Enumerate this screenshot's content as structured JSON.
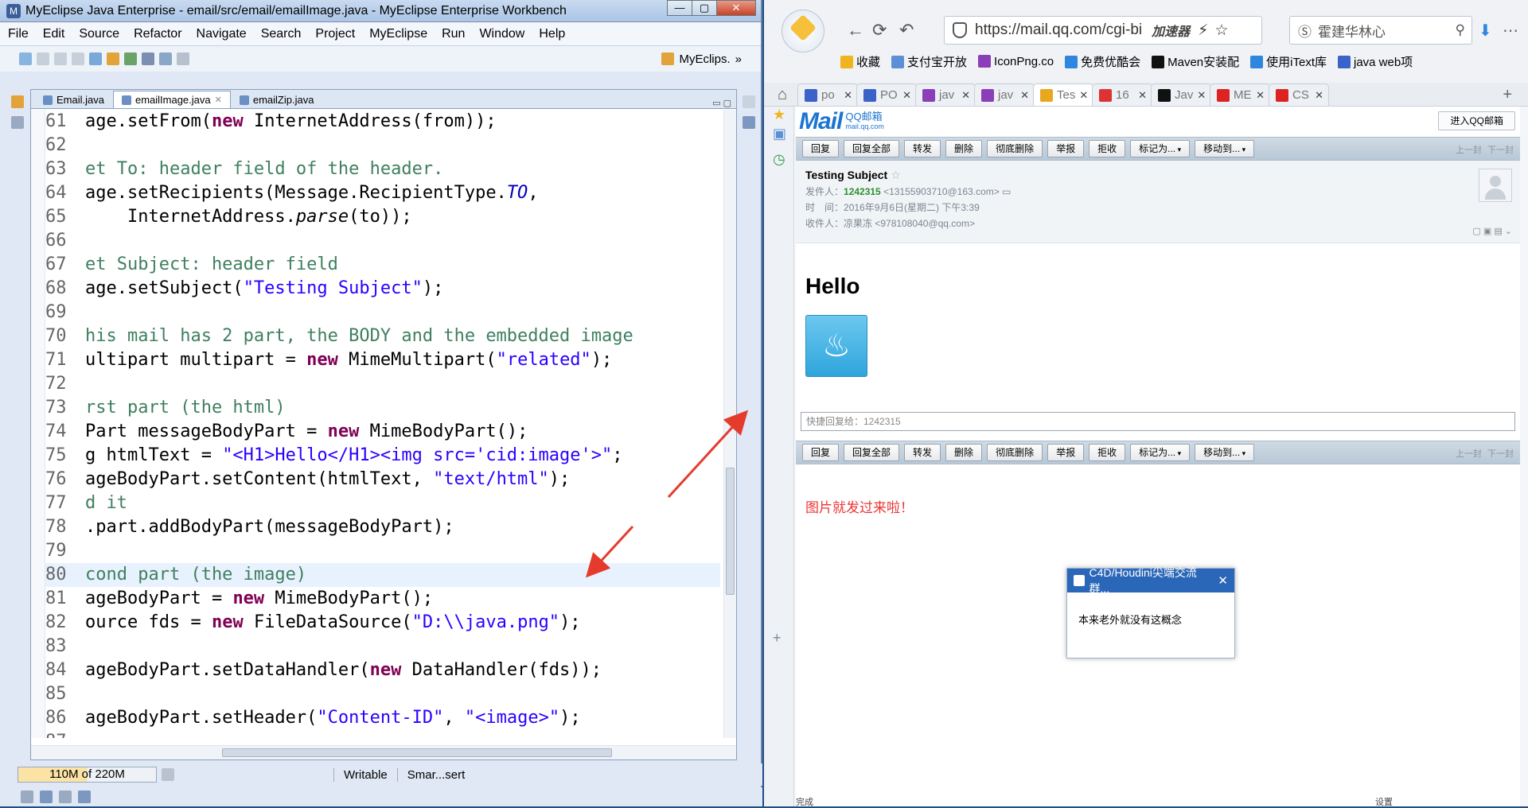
{
  "eclipse": {
    "title": "MyEclipse Java Enterprise - email/src/email/emailImage.java - MyEclipse Enterprise Workbench",
    "menu": [
      "File",
      "Edit",
      "Source",
      "Refactor",
      "Navigate",
      "Search",
      "Project",
      "MyEclipse",
      "Run",
      "Window",
      "Help"
    ],
    "perspective": "MyEclips.",
    "tabs": [
      {
        "label": "Email.java",
        "active": false
      },
      {
        "label": "emailImage.java",
        "active": true
      },
      {
        "label": "emailZip.java",
        "active": false
      }
    ],
    "code_lines": [
      {
        "n": "61",
        "html": "age.setFrom(<span class=\"kw\">new</span> InternetAddress(from));"
      },
      {
        "n": "62",
        "html": ""
      },
      {
        "n": "63",
        "html": "<span class=\"cm\">et To: header field of the header.</span>"
      },
      {
        "n": "64",
        "html": "age.setRecipients(Message.RecipientType.<span class=\"stat\">TO</span>,"
      },
      {
        "n": "65",
        "html": "    InternetAddress.<span class=\"it\">parse</span>(to));"
      },
      {
        "n": "66",
        "html": ""
      },
      {
        "n": "67",
        "html": "<span class=\"cm\">et Subject: header field</span>"
      },
      {
        "n": "68",
        "html": "age.setSubject(<span class=\"str\">\"Testing Subject\"</span>);"
      },
      {
        "n": "69",
        "html": ""
      },
      {
        "n": "70",
        "html": "<span class=\"cm\">his mail has 2 part, the BODY and the embedded image</span>"
      },
      {
        "n": "71",
        "html": "ultipart multipart = <span class=\"kw\">new</span> MimeMultipart(<span class=\"str\">\"related\"</span>);"
      },
      {
        "n": "72",
        "html": ""
      },
      {
        "n": "73",
        "html": "<span class=\"cm\">rst part (the html)</span>"
      },
      {
        "n": "74",
        "html": "Part messageBodyPart = <span class=\"kw\">new</span> MimeBodyPart();"
      },
      {
        "n": "75",
        "html": "g htmlText = <span class=\"str\">\"&lt;H1&gt;Hello&lt;/H1&gt;&lt;img src='cid:image'&gt;\"</span>;"
      },
      {
        "n": "76",
        "html": "ageBodyPart.setContent(htmlText, <span class=\"str\">\"text/html\"</span>);"
      },
      {
        "n": "77",
        "html": "<span class=\"cm\">d it</span>"
      },
      {
        "n": "78",
        "html": ".part.addBodyPart(messageBodyPart);"
      },
      {
        "n": "79",
        "html": ""
      },
      {
        "n": "80",
        "html": "<span class=\"cm\">cond part (the image)</span>",
        "hl": true
      },
      {
        "n": "81",
        "html": "ageBodyPart = <span class=\"kw\">new</span> MimeBodyPart();"
      },
      {
        "n": "82",
        "html": "ource fds = <span class=\"kw\">new</span> FileDataSource(<span class=\"str\">\"D:\\\\java.png\"</span>);"
      },
      {
        "n": "83",
        "html": ""
      },
      {
        "n": "84",
        "html": "ageBodyPart.setDataHandler(<span class=\"kw\">new</span> DataHandler(fds));"
      },
      {
        "n": "85",
        "html": ""
      },
      {
        "n": "86",
        "html": "ageBodyPart.setHeader(<span class=\"str\">\"Content-ID\"</span>, <span class=\"str\">\"&lt;image&gt;\"</span>);"
      },
      {
        "n": "87",
        "html": ""
      }
    ],
    "status": {
      "heap": "110M of 220M",
      "mode": "Writable",
      "insert": "Smar...sert"
    }
  },
  "browser": {
    "url": "https://mail.qq.com/cgi-bi",
    "accelerator": "加速器",
    "search_text": "霍建华林心",
    "bookmarks": [
      "收藏",
      "支付宝开放",
      "IconPng.co",
      "免费优酷会",
      "Maven安装配",
      "使用iText库",
      "java web项"
    ],
    "tabs": [
      {
        "label": "po",
        "color": "#3a62c9"
      },
      {
        "label": "PO",
        "color": "#3a62c9"
      },
      {
        "label": "jav",
        "color": "#8a3fb8"
      },
      {
        "label": "jav",
        "color": "#8a3fb8"
      },
      {
        "label": "Tes",
        "color": "#e8a71d",
        "active": true
      },
      {
        "label": "16",
        "color": "#d33"
      },
      {
        "label": "Jav",
        "color": "#111"
      },
      {
        "label": "ME",
        "color": "#d22"
      },
      {
        "label": "CS",
        "color": "#d22"
      }
    ],
    "logo_text": "QQ邮箱",
    "logo_sub": "mail.qq.com",
    "enter_qq": "进入QQ邮箱",
    "toolbar": [
      {
        "label": "回复"
      },
      {
        "label": "回复全部"
      },
      {
        "label": "转发"
      },
      {
        "label": "删除"
      },
      {
        "label": "彻底删除"
      },
      {
        "label": "举报"
      },
      {
        "label": "拒收"
      },
      {
        "label": "标记为...",
        "dd": true
      },
      {
        "label": "移动到...",
        "dd": true
      }
    ],
    "pager": "上一封 下一封",
    "mail": {
      "subject": "Testing Subject",
      "from_label": "发件人：",
      "from_name": "1242315",
      "from_addr": "<13155903710@163.com>",
      "time_label": "时　间：",
      "time": "2016年9月6日(星期二) 下午3:39",
      "to_label": "收件人：",
      "to": "凉果冻 <978108040@qq.com>",
      "hello": "Hello",
      "quick_reply": "快捷回复给：1242315",
      "note": "图片就发过来啦！"
    },
    "popup": {
      "title": "C4D/Houdini尖端交流群...",
      "body": "本来老外就没有这概念"
    },
    "status_left": "完成",
    "status_right": "设置"
  }
}
